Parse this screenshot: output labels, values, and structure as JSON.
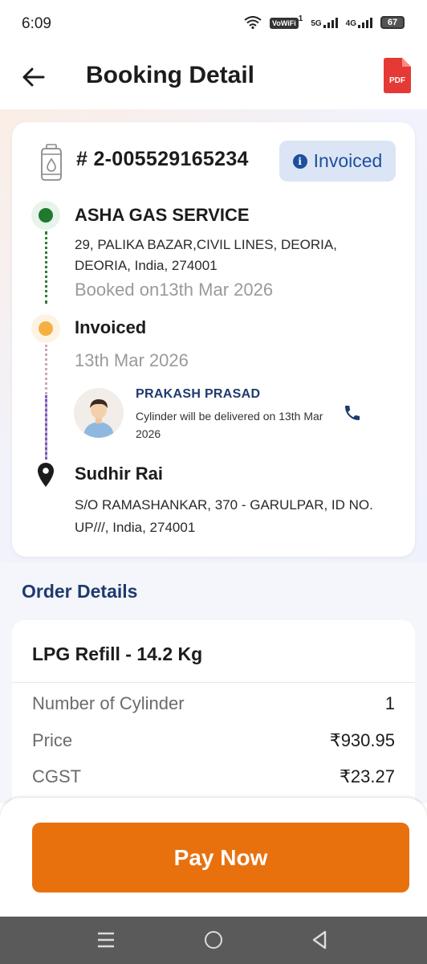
{
  "status_bar": {
    "time": "6:09",
    "vowifi": "VoWiFi",
    "vowifi_sup": "1",
    "net1": "5G",
    "net2": "4G",
    "battery": "67"
  },
  "header": {
    "title": "Booking Detail",
    "pdf_label": "PDF"
  },
  "booking": {
    "id": "# 2-005529165234",
    "status": "Invoiced",
    "agency_name": "ASHA GAS SERVICE",
    "agency_address": "29, PALIKA BAZAR,CIVIL LINES, DEORIA, DEORIA, India, 274001",
    "booked_on": "Booked on13th Mar 2026",
    "invoiced_label": "Invoiced",
    "invoiced_date": "13th Mar 2026",
    "delivery_agent": "PRAKASH PRASAD",
    "delivery_message": "Cylinder will be delivered on 13th Mar 2026",
    "customer_name": "Sudhir Rai",
    "customer_address": "S/O RAMASHANKAR, 370 - GARULPAR, ID NO. UP///, India, 274001"
  },
  "order": {
    "section_title": "Order Details",
    "product": "LPG Refill - 14.2 Kg",
    "rows": [
      {
        "label": "Number of Cylinder",
        "value": "1"
      },
      {
        "label": "Price",
        "value": "₹930.95"
      },
      {
        "label": "CGST",
        "value": "₹23.27"
      }
    ]
  },
  "actions": {
    "pay_now": "Pay Now"
  },
  "colors": {
    "accent": "#e8710e",
    "brand_blue": "#1e3a6e",
    "status_green": "#1f7a2e",
    "status_yellow": "#f5b041"
  }
}
